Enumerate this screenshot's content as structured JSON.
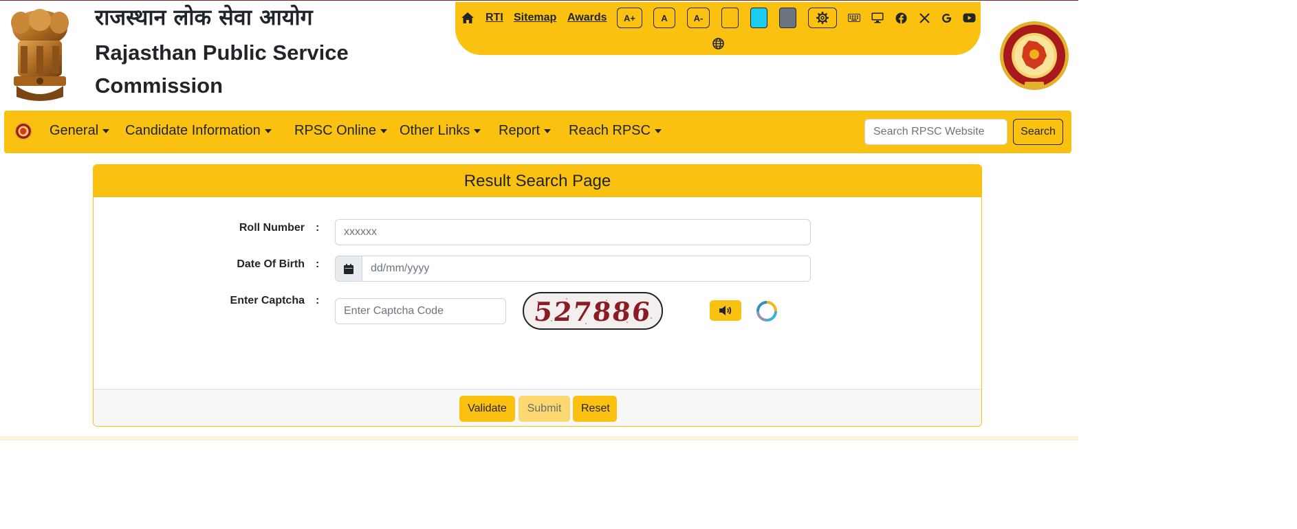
{
  "header": {
    "title_hindi": "राजस्थान लोक सेवा आयोग",
    "title_english": "Rajasthan Public Service Commission"
  },
  "topbar": {
    "links": [
      "RTI",
      "Sitemap",
      "Awards"
    ],
    "font_buttons": [
      "A+",
      "A",
      "A-"
    ],
    "theme_swatches": [
      "#fbc111",
      "#1ccbf2",
      "#6c757d"
    ],
    "icons": [
      "home-icon",
      "gear-icon",
      "keyboard-icon",
      "monitor-icon",
      "facebook-icon",
      "x-icon",
      "google-icon",
      "youtube-icon",
      "globe-icon"
    ]
  },
  "navbar": {
    "items": [
      "General",
      "Candidate Information",
      "RPSC Online",
      "Other Links",
      "Report",
      "Reach RPSC"
    ],
    "search_placeholder": "Search RPSC Website",
    "search_button": "Search"
  },
  "form": {
    "title": "Result Search Page",
    "roll_label": "Roll Number",
    "roll_placeholder": "xxxxxx",
    "dob_label": "Date Of Birth",
    "dob_placeholder": "dd/mm/yyyy",
    "captcha_label": "Enter Captcha",
    "captcha_placeholder": "Enter Captcha Code",
    "captcha_code": "527886",
    "colon": ":"
  },
  "footer_buttons": {
    "validate": "Validate",
    "submit": "Submit",
    "reset": "Reset"
  },
  "colors": {
    "accent": "#fbc111",
    "maroon": "#8c1c24"
  }
}
